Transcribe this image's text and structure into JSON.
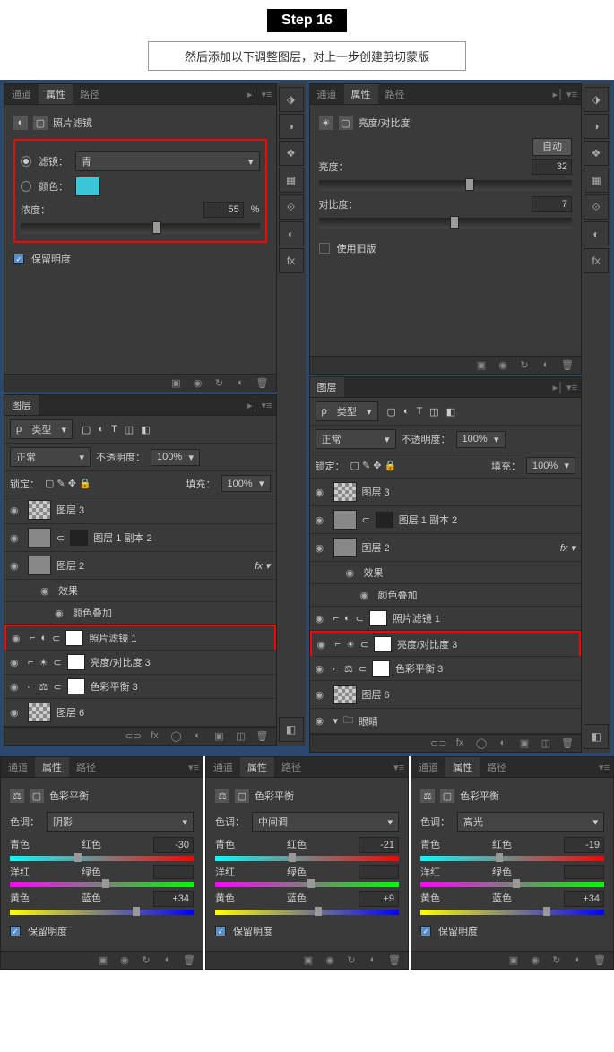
{
  "step": "Step 16",
  "description": "然后添加以下调整图层，对上一步创建剪切蒙版",
  "tabs": {
    "channel": "通道",
    "properties": "属性",
    "path": "路径",
    "layers": "图层"
  },
  "photo_filter": {
    "title": "照片滤镜",
    "filter_label": "滤镜：",
    "filter_value": "青",
    "color_label": "颜色：",
    "density_label": "浓度：",
    "density_value": "55",
    "density_unit": "%",
    "preserve": "保留明度"
  },
  "brightness": {
    "title": "亮度/对比度",
    "auto": "自动",
    "bright_label": "亮度：",
    "bright_value": "32",
    "contrast_label": "对比度：",
    "contrast_value": "7",
    "legacy": "使用旧版"
  },
  "layers_panel": {
    "kind": "类型",
    "blend": "正常",
    "opacity_label": "不透明度：",
    "opacity": "100%",
    "lock": "锁定：",
    "fill_label": "填充：",
    "fill": "100%",
    "items": {
      "l3": "图层 3",
      "l1copy": "图层 1 副本 2",
      "l2": "图层 2",
      "fx": "效果",
      "overlay": "颜色叠加",
      "pf": "照片滤镜 1",
      "bc": "亮度/对比度 3",
      "cb": "色彩平衡 3",
      "l6": "图层 6",
      "eyes": "眼睛"
    }
  },
  "color_balance": {
    "title": "色彩平衡",
    "tone": "色调：",
    "tones": {
      "shadows": "阴影",
      "midtones": "中间调",
      "highlights": "高光"
    },
    "cyan": "青色",
    "red": "红色",
    "magenta": "洋红",
    "green": "绿色",
    "yellow": "黄色",
    "blue": "蓝色",
    "preserve": "保留明度",
    "vals": {
      "shadows": {
        "r": "-30",
        "g": "",
        "b": "+34"
      },
      "midtones": {
        "r": "-21",
        "g": "",
        "b": "+9"
      },
      "highlights": {
        "r": "-19",
        "g": "",
        "b": "+34"
      }
    }
  }
}
